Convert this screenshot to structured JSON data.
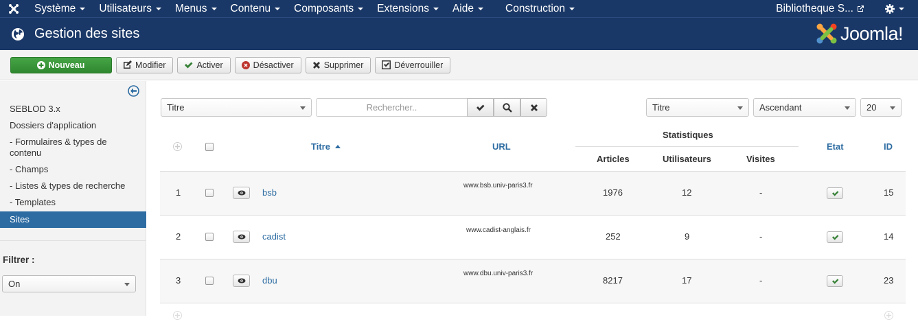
{
  "topbar": {
    "menu": [
      {
        "label": "Système"
      },
      {
        "label": "Utilisateurs"
      },
      {
        "label": "Menus"
      },
      {
        "label": "Contenu"
      },
      {
        "label": "Composants"
      },
      {
        "label": "Extensions"
      },
      {
        "label": "Aide"
      },
      {
        "label": "Construction"
      }
    ],
    "site_link": "Bibliotheque S..."
  },
  "header": {
    "title": "Gestion des sites",
    "brand": "Joomla!"
  },
  "toolbar": {
    "new": "Nouveau",
    "edit": "Modifier",
    "activate": "Activer",
    "deactivate": "Désactiver",
    "delete": "Supprimer",
    "unlock": "Déverrouiller"
  },
  "sidebar": {
    "items": [
      {
        "label": "SEBLOD 3.x"
      },
      {
        "label": "Dossiers d'application"
      },
      {
        "label": "- Formulaires & types de contenu"
      },
      {
        "label": "- Champs"
      },
      {
        "label": "- Listes & types de recherche"
      },
      {
        "label": "- Templates"
      },
      {
        "label": "Sites"
      }
    ],
    "filter_label": "Filtrer :",
    "filter_value": "On"
  },
  "filters": {
    "search_field": "Titre",
    "search_placeholder": "Rechercher..",
    "sort_field": "Titre",
    "sort_order": "Ascendant",
    "limit": "20"
  },
  "table": {
    "headers": {
      "title": "Titre",
      "url": "URL",
      "stats": "Statistiques",
      "articles": "Articles",
      "users": "Utilisateurs",
      "visits": "Visites",
      "state": "Etat",
      "id": "ID"
    },
    "rows": [
      {
        "num": "1",
        "title": "bsb",
        "url": "www.bsb.univ-paris3.fr",
        "articles": "1976",
        "users": "12",
        "visits": "-",
        "id": "15"
      },
      {
        "num": "2",
        "title": "cadist",
        "url": "www.cadist-anglais.fr",
        "articles": "252",
        "users": "9",
        "visits": "-",
        "id": "14"
      },
      {
        "num": "3",
        "title": "dbu",
        "url": "www.dbu.univ-paris3.fr",
        "articles": "8217",
        "users": "17",
        "visits": "-",
        "id": "23"
      }
    ]
  }
}
